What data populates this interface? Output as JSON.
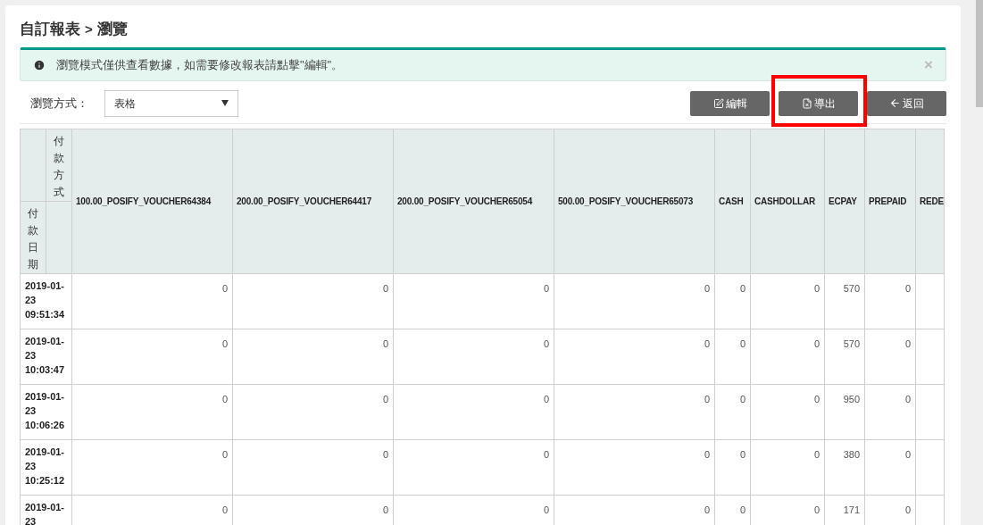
{
  "breadcrumb": {
    "section": "自訂報表",
    "separator": ">",
    "page": "瀏覽"
  },
  "alert": {
    "message": "瀏覽模式僅供查看數據，如需要修改報表請點擊\"編輯\"。",
    "close": "×"
  },
  "view_mode": {
    "label": "瀏覽方式：",
    "value": "表格"
  },
  "buttons": [
    {
      "kind": "edit",
      "label": "編輯",
      "highlighted": false
    },
    {
      "kind": "export",
      "label": "導出",
      "highlighted": true
    },
    {
      "kind": "back",
      "label": "返回",
      "highlighted": false
    }
  ],
  "table": {
    "corner_column_label": "付款方式",
    "corner_row_label": "付款日期",
    "columns": [
      "100.00_POSIFY_VOUCHER64384",
      "200.00_POSIFY_VOUCHER64417",
      "200.00_POSIFY_VOUCHER65054",
      "500.00_POSIFY_VOUCHER65073",
      "CASH",
      "CASHDOLLAR",
      "ECPAY",
      "PREPAID",
      "REDE"
    ],
    "rows": [
      {
        "date": "2019-01-23 09:51:34",
        "values": [
          "0",
          "0",
          "0",
          "0",
          "0",
          "0",
          "570",
          "0"
        ]
      },
      {
        "date": "2019-01-23 10:03:47",
        "values": [
          "0",
          "0",
          "0",
          "0",
          "0",
          "0",
          "570",
          "0"
        ]
      },
      {
        "date": "2019-01-23 10:06:26",
        "values": [
          "0",
          "0",
          "0",
          "0",
          "0",
          "0",
          "950",
          "0"
        ]
      },
      {
        "date": "2019-01-23 10:25:12",
        "values": [
          "0",
          "0",
          "0",
          "0",
          "0",
          "0",
          "380",
          "0"
        ]
      },
      {
        "date": "2019-01-23",
        "values": [
          "0",
          "0",
          "0",
          "0",
          "0",
          "0",
          "171",
          "0"
        ]
      }
    ]
  }
}
